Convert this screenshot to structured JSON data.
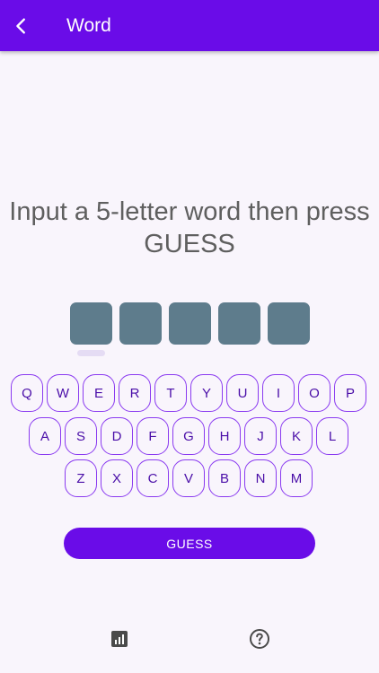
{
  "appbar": {
    "title": "Word",
    "back_icon": "chevron-left-icon",
    "color": "#6a0ce8"
  },
  "prompt": "Input a 5-letter word then press GUESS",
  "tiles": [
    "",
    "",
    "",
    "",
    ""
  ],
  "keyboard": {
    "row1": [
      "Q",
      "W",
      "E",
      "R",
      "T",
      "Y",
      "U",
      "I",
      "O",
      "P"
    ],
    "row2": [
      "A",
      "S",
      "D",
      "F",
      "G",
      "H",
      "J",
      "K",
      "L"
    ],
    "row3": [
      "Z",
      "X",
      "C",
      "V",
      "B",
      "N",
      "M"
    ]
  },
  "guess_button": {
    "label": "GUESS"
  },
  "bottom_icons": [
    "stats-icon",
    "help-icon"
  ]
}
